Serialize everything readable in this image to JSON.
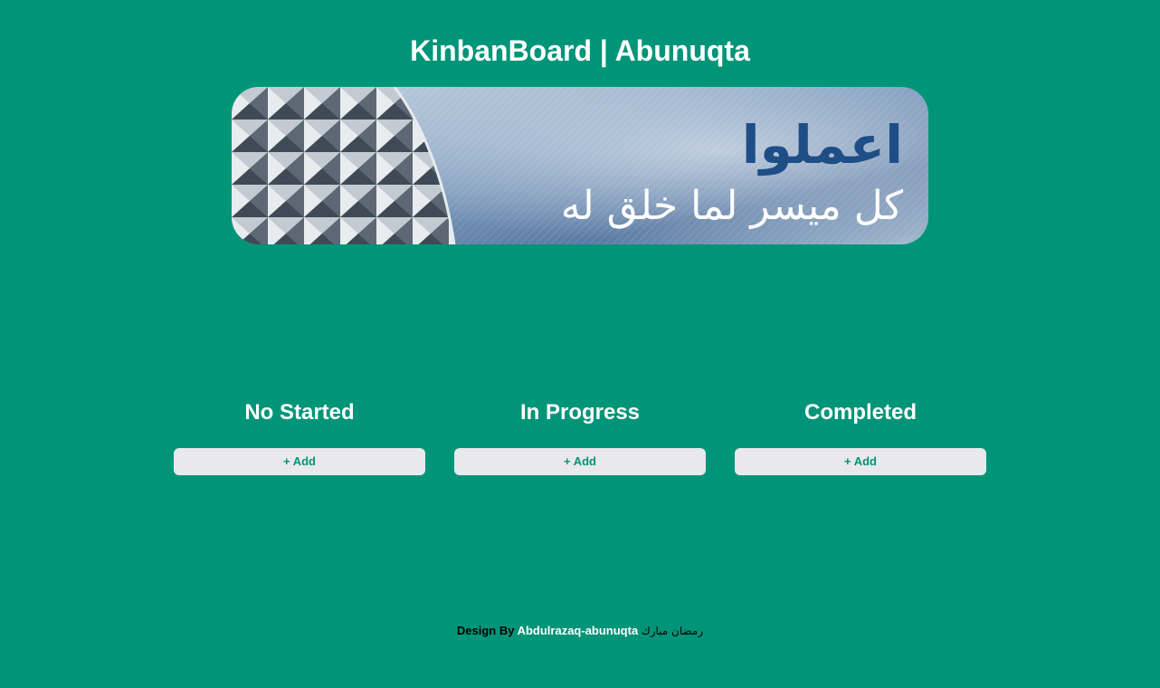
{
  "header": {
    "title": "KinbanBoard | Abunuqta"
  },
  "banner": {
    "headline_ar": "اعملوا",
    "subline_ar": "كل ميسر لما خلق له",
    "colors": {
      "sky": "#5b7fa8",
      "text": "#1f4e86"
    }
  },
  "board": {
    "columns": [
      {
        "title": "No Started",
        "add_label": "+ Add"
      },
      {
        "title": "In Progress",
        "add_label": "+ Add"
      },
      {
        "title": "Completed",
        "add_label": "+ Add"
      }
    ]
  },
  "footer": {
    "prefix": "Design By",
    "author": "Abdulrazaq-abunuqta",
    "greeting_ar": "رمضان مبارك"
  },
  "theme": {
    "background": "#009578",
    "button_bg": "#e9e8ec",
    "button_text": "#009578"
  }
}
